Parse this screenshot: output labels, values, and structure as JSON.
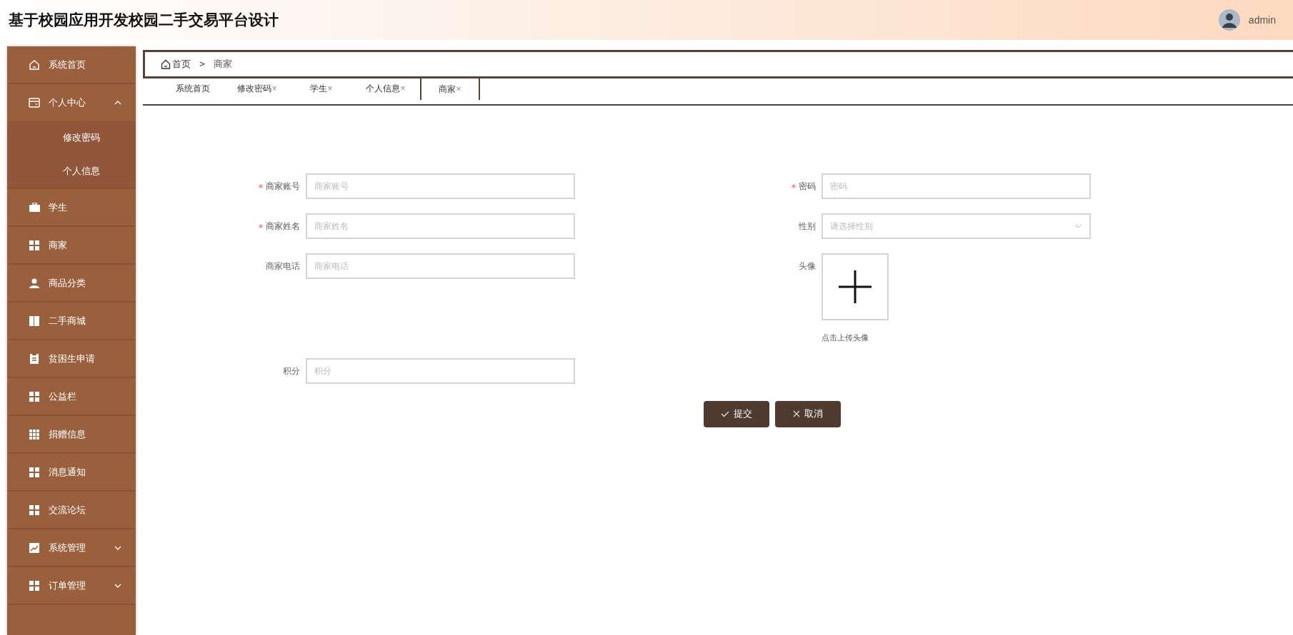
{
  "header": {
    "title": "基于校园应用开发校园二手交易平台设计",
    "user": {
      "name": "admin"
    }
  },
  "sidebar": {
    "items": [
      {
        "label": "系统首页"
      },
      {
        "label": "个人中心",
        "expanded": true,
        "children": [
          {
            "label": "修改密码"
          },
          {
            "label": "个人信息"
          }
        ]
      },
      {
        "label": "学生"
      },
      {
        "label": "商家"
      },
      {
        "label": "商品分类"
      },
      {
        "label": "二手商城"
      },
      {
        "label": "贫困生申请"
      },
      {
        "label": "公益栏"
      },
      {
        "label": "捐赠信息"
      },
      {
        "label": "消息通知"
      },
      {
        "label": "交流论坛"
      },
      {
        "label": "系统管理",
        "expanded": false
      },
      {
        "label": "订单管理",
        "expanded": false
      }
    ]
  },
  "breadcrumb": {
    "home": "首页",
    "separator": ">",
    "current": "商家"
  },
  "tabs": [
    {
      "label": "系统首页",
      "selected": false
    },
    {
      "label": "修改密码",
      "close": "×",
      "selected": false
    },
    {
      "label": "学生",
      "close": "×",
      "selected": false
    },
    {
      "label": "个人信息",
      "close": "×",
      "selected": false
    },
    {
      "label": "商家",
      "close": "×",
      "selected": true
    }
  ],
  "form": {
    "fields": [
      {
        "kind": "input",
        "label": "商家账号",
        "required": true,
        "placeholder": "商家账号"
      },
      {
        "kind": "input",
        "label": "密码",
        "required": true,
        "placeholder": "密码"
      },
      {
        "kind": "input",
        "label": "商家姓名",
        "required": true,
        "placeholder": "商家姓名"
      },
      {
        "kind": "select",
        "label": "性别",
        "required": false,
        "placeholder": "请选择性别"
      },
      {
        "kind": "input",
        "label": "商家电话",
        "required": false,
        "placeholder": "商家电话"
      },
      {
        "kind": "upload",
        "label": "头像",
        "required": false,
        "hint": "点击上传头像"
      },
      {
        "kind": "input",
        "label": "积分",
        "required": false,
        "placeholder": "积分"
      }
    ],
    "buttons": [
      {
        "kind": "submit",
        "label": "提交"
      },
      {
        "kind": "cancel",
        "label": "取消"
      }
    ]
  }
}
